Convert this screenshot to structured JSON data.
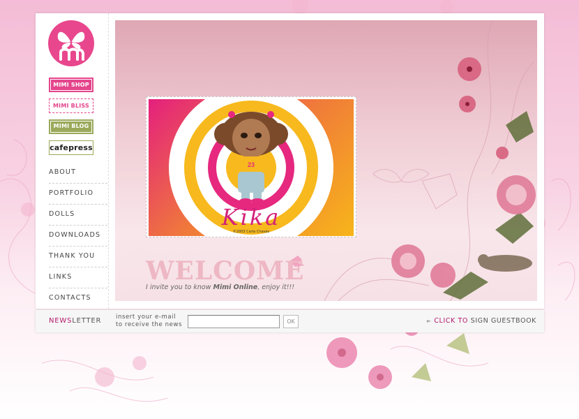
{
  "brand": {
    "logo_icon": "butterfly-m-icon"
  },
  "badges": {
    "shop": "MIMI SHOP",
    "bliss": "MIMI BLISS",
    "blog": "MIMI BLOG",
    "cafepress": "cafepress"
  },
  "nav": [
    "ABOUT",
    "PORTFOLIO",
    "DOLLS",
    "DOWNLOADS",
    "THANK YOU",
    "LINKS",
    "CONTACTS"
  ],
  "feature": {
    "name": "Kika",
    "credit": "©2003 Carla Chaves",
    "shirt_number": "23"
  },
  "welcome": {
    "title": "WELCOME",
    "intro_pre": "I invite you to know ",
    "intro_bold": "Mimi Online",
    "intro_post": ", enjoy it!!!"
  },
  "newsletter": {
    "title_hl": "NEWS",
    "title_rest": "LETTER",
    "hint_line1": "insert your e-mail",
    "hint_line2": "to receive the news",
    "email_value": "",
    "ok_label": "OK"
  },
  "guestbook": {
    "arrow": "►",
    "click_label": "CLICK TO",
    "rest_label": " SIGN GUESTBOOK"
  },
  "colors": {
    "accent_pink": "#e4458c",
    "accent_green": "#9aa95a",
    "link_magenta": "#b3186a"
  }
}
